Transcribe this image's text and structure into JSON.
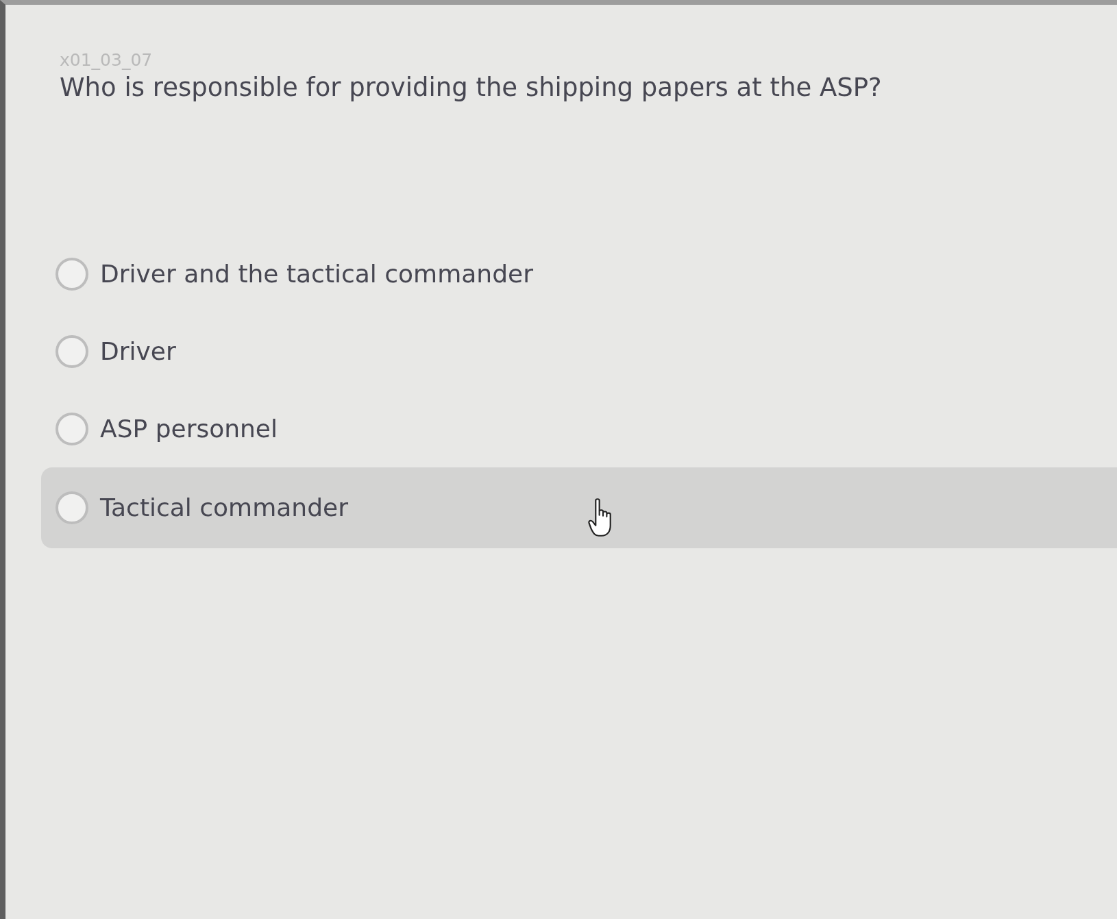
{
  "question": {
    "id": "x01_03_07",
    "text": "Who is responsible for providing the shipping papers at the ASP?"
  },
  "options": [
    {
      "label": "Driver and the tactical commander",
      "selected": false,
      "hovered": false
    },
    {
      "label": "Driver",
      "selected": false,
      "hovered": false
    },
    {
      "label": "ASP personnel",
      "selected": false,
      "hovered": false
    },
    {
      "label": "Tactical commander",
      "selected": false,
      "hovered": true
    }
  ]
}
